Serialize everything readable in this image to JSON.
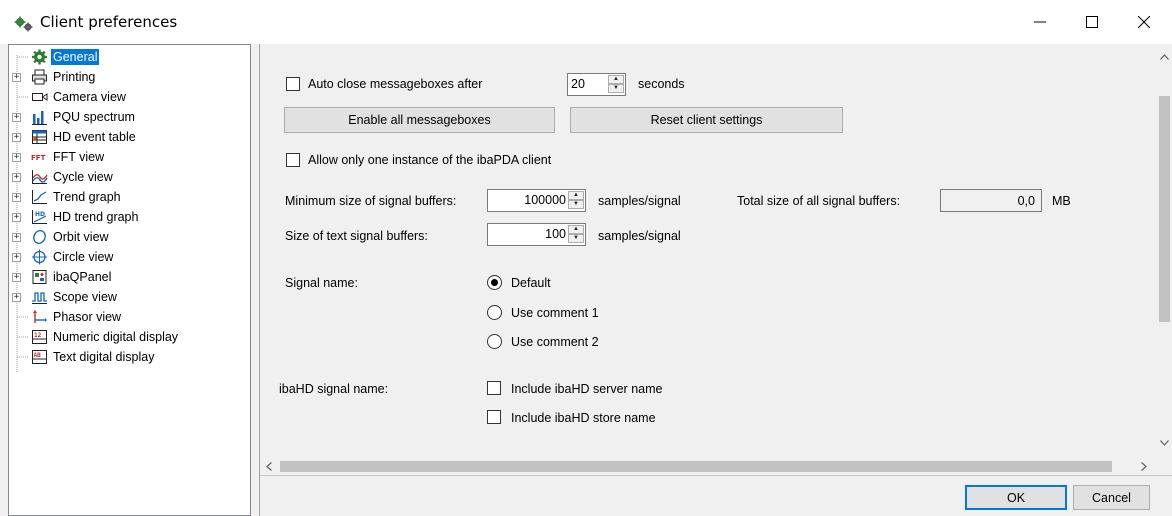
{
  "window": {
    "title": "Client preferences",
    "icon": "gears-icon"
  },
  "tree": {
    "items": [
      {
        "label": "General",
        "icon": "gear-icon",
        "expandable": false,
        "selected": true
      },
      {
        "label": "Printing",
        "icon": "printer-icon",
        "expandable": true
      },
      {
        "label": "Camera view",
        "icon": "camera-icon",
        "expandable": false
      },
      {
        "label": "PQU spectrum",
        "icon": "spectrum-icon",
        "expandable": true
      },
      {
        "label": "HD event table",
        "icon": "event-table-icon",
        "expandable": true
      },
      {
        "label": "FFT view",
        "icon": "fft-icon",
        "expandable": true
      },
      {
        "label": "Cycle view",
        "icon": "cycle-icon",
        "expandable": true
      },
      {
        "label": "Trend graph",
        "icon": "trend-icon",
        "expandable": true
      },
      {
        "label": "HD trend graph",
        "icon": "hd-trend-icon",
        "expandable": true
      },
      {
        "label": "Orbit view",
        "icon": "orbit-icon",
        "expandable": true
      },
      {
        "label": "Circle view",
        "icon": "circle-icon",
        "expandable": true
      },
      {
        "label": "ibaQPanel",
        "icon": "qpanel-icon",
        "expandable": true
      },
      {
        "label": "Scope view",
        "icon": "scope-icon",
        "expandable": true
      },
      {
        "label": "Phasor view",
        "icon": "phasor-icon",
        "expandable": false
      },
      {
        "label": "Numeric digital display",
        "icon": "numeric-display-icon",
        "expandable": false
      },
      {
        "label": "Text digital display",
        "icon": "text-display-icon",
        "expandable": false
      }
    ]
  },
  "general": {
    "auto_close_label": "Auto close messageboxes after",
    "auto_close_checked": false,
    "auto_close_value": "20",
    "seconds_label": "seconds",
    "enable_all_label": "Enable all messageboxes",
    "reset_label": "Reset client settings",
    "one_instance_label": "Allow only one instance of the ibaPDA client",
    "one_instance_checked": false,
    "min_size_label": "Minimum size of signal buffers:",
    "min_size_value": "100000",
    "samples_unit": "samples/signal",
    "total_size_label": "Total size of all signal buffers:",
    "total_size_value": "0,0",
    "total_size_unit": "MB",
    "text_size_label": "Size of text signal buffers:",
    "text_size_value": "100",
    "signal_name_label": "Signal name:",
    "signal_name_options": [
      "Default",
      "Use comment 1",
      "Use comment 2"
    ],
    "signal_name_selected": "Default",
    "hd_signal_name_label": "ibaHD signal name:",
    "include_server_label": "Include ibaHD server name",
    "include_store_label": "Include ibaHD store name"
  },
  "footer": {
    "ok_label": "OK",
    "cancel_label": "Cancel"
  },
  "colors": {
    "selection": "#0078d7",
    "window_bg": "#f0f0f0"
  }
}
